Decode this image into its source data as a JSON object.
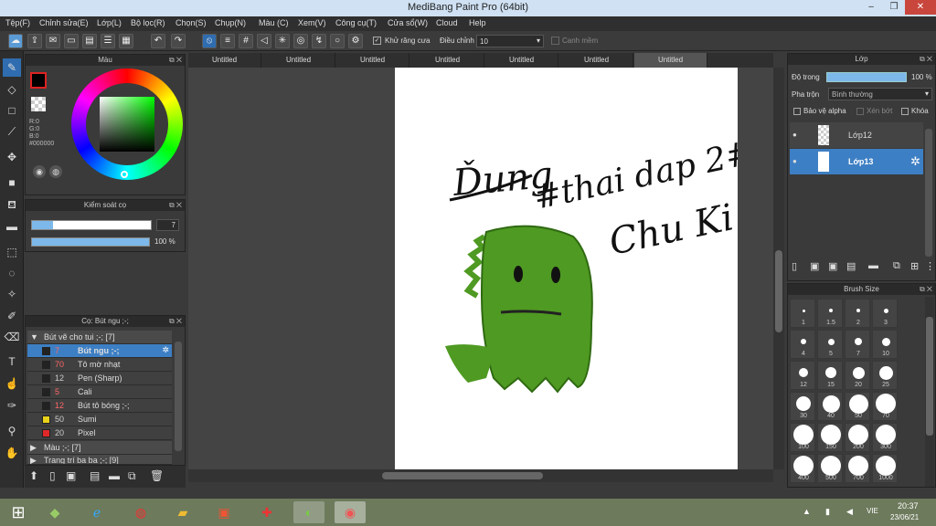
{
  "window": {
    "title": "MediBang Paint Pro (64bit)",
    "min": "–",
    "max": "❐",
    "close": "✕"
  },
  "menu": [
    "Tệp(F)",
    "Chỉnh sửa(E)",
    "Lớp(L)",
    "Bộ lọc(R)",
    "Chọn(S)",
    "Chụp(N)",
    "Màu (C)",
    "Xem(V)",
    "Công cụ(T)",
    "Cửa sổ(W)",
    "Cloud",
    "Help"
  ],
  "toolbar": {
    "antialias_label": "Khử răng cưa",
    "adjust_label": "Điều chỉnh",
    "adjust_value": "10",
    "smooth_label": "Canh mềm"
  },
  "color_panel": {
    "title": "Màu",
    "r": "R:0",
    "g": "G:0",
    "b": "B:0",
    "hex": "#000000"
  },
  "brush_control": {
    "title": "Kiểm soát cọ",
    "size": "7",
    "opacity": "100 %",
    "size_fraction": 0.07,
    "opacity_fraction": 1.0
  },
  "brush_panel": {
    "title": "Cọ: Bút ngu ;-;",
    "group": "Bút vẽ cho tui ;-; [7]",
    "brushes": [
      {
        "size": "7",
        "name": "Bút ngu ;-;",
        "color": "#222222",
        "selected": true
      },
      {
        "size": "70",
        "name": "Tô mờ nhạt",
        "color": "#222222"
      },
      {
        "size": "12",
        "name": "Pen (Sharp)",
        "color": "#222222"
      },
      {
        "size": "5",
        "name": "Cali",
        "color": "#222222"
      },
      {
        "size": "12",
        "name": "Bút tô bóng ;-;",
        "color": "#222222"
      },
      {
        "size": "50",
        "name": "Sumi",
        "color": "#e8d21a"
      },
      {
        "size": "20",
        "name": "Pixel",
        "color": "#e02828"
      }
    ],
    "group2": "Màu ;-; [7]",
    "group3": "Trang trí ba ba ;-; [9]"
  },
  "tabs": [
    "Untitled",
    "Untitled",
    "Untitled",
    "Untitled",
    "Untitled",
    "Untitled",
    "Untitled"
  ],
  "canvas_text": {
    "sig": "Ďung",
    "line1": "#thai dap 2#",
    "line2": "Chu Ki"
  },
  "layer_panel": {
    "title": "Lớp",
    "opacity_label": "Độ trong",
    "opacity_value": "100 %",
    "blend_label": "Pha trộn",
    "blend_value": "Bình thường",
    "protect_alpha": "Bảo vệ alpha",
    "clip": "Xén bớt",
    "lock": "Khóa",
    "layers": [
      {
        "name": "Lớp12",
        "selected": false
      },
      {
        "name": "Lớp13",
        "selected": true
      }
    ]
  },
  "size_panel": {
    "title": "Brush Size",
    "sizes": [
      "1",
      "1.5",
      "2",
      "3",
      "4",
      "5",
      "7",
      "10",
      "12",
      "15",
      "20",
      "25",
      "30",
      "40",
      "50",
      "70",
      "100",
      "150",
      "200",
      "300",
      "400",
      "500",
      "700",
      "1000"
    ]
  },
  "taskbar": {
    "lang": "VIE",
    "time": "20:37",
    "date": "23/06/21"
  },
  "colors": {
    "accent": "#5b9bd5",
    "selected_row": "#3d7fc4",
    "canvas": "#ffffff",
    "dino": "#4f9a22"
  }
}
